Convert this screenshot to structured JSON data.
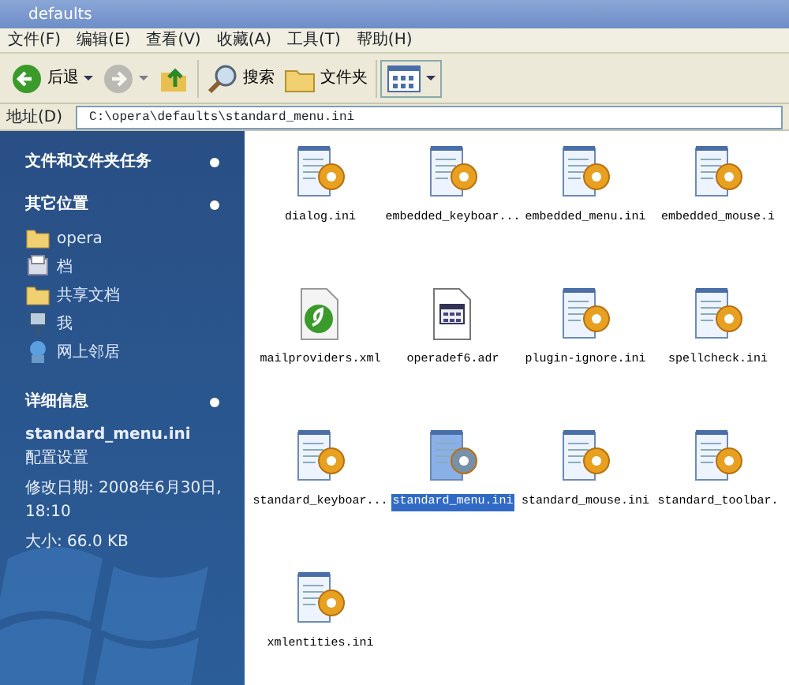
{
  "window": {
    "title": "defaults"
  },
  "menu": [
    "文件(F)",
    "编辑(E)",
    "查看(V)",
    "收藏(A)",
    "工具(T)",
    "帮助(H)"
  ],
  "toolbar": [
    {
      "kind": "back",
      "label": "后退",
      "disabled": false
    },
    {
      "kind": "forward",
      "disabled": true
    },
    {
      "kind": "up"
    },
    {
      "kind": "search",
      "label": "搜索"
    },
    {
      "kind": "folders",
      "label": "文件夹"
    },
    {
      "kind": "views"
    }
  ],
  "address": {
    "label": "地址(D)",
    "value": "C:\\opera\\defaults\\standard_menu.ini"
  },
  "sidebar": {
    "sections": [
      {
        "title": "文件和文件夹任务"
      },
      {
        "title": "其它位置",
        "items": [
          {
            "kind": "folder",
            "label": "opera"
          },
          {
            "kind": "document",
            "label": "档"
          },
          {
            "kind": "folder",
            "label": "共享文档"
          },
          {
            "kind": "computer",
            "label": "我"
          },
          {
            "kind": "network",
            "label": "网上邻居"
          }
        ]
      },
      {
        "title": "详细信息",
        "details": {
          "name": "standard_menu.ini",
          "type": "配置设置",
          "modified": "修改日期: 2008年6月30日, 18:10",
          "size": "大小: 66.0 KB"
        }
      }
    ]
  },
  "files": [
    {
      "name": "dialog.ini",
      "kind": "ini",
      "selected": false
    },
    {
      "name": "embedded_keyboar...",
      "kind": "ini",
      "selected": false
    },
    {
      "name": "embedded_menu.ini",
      "kind": "ini",
      "selected": false
    },
    {
      "name": "embedded_mouse.i",
      "kind": "ini",
      "selected": false
    },
    {
      "name": "mailproviders.xml",
      "kind": "xml",
      "selected": false
    },
    {
      "name": "operadef6.adr",
      "kind": "adr",
      "selected": false
    },
    {
      "name": "plugin-ignore.ini",
      "kind": "ini",
      "selected": false
    },
    {
      "name": "spellcheck.ini",
      "kind": "ini",
      "selected": false
    },
    {
      "name": "standard_keyboar...",
      "kind": "ini",
      "selected": false
    },
    {
      "name": "standard_menu.ini",
      "kind": "ini",
      "selected": true
    },
    {
      "name": "standard_mouse.ini",
      "kind": "ini",
      "selected": false
    },
    {
      "name": "standard_toolbar.",
      "kind": "ini",
      "selected": false
    },
    {
      "name": "xmlentities.ini",
      "kind": "ini",
      "selected": false
    }
  ]
}
